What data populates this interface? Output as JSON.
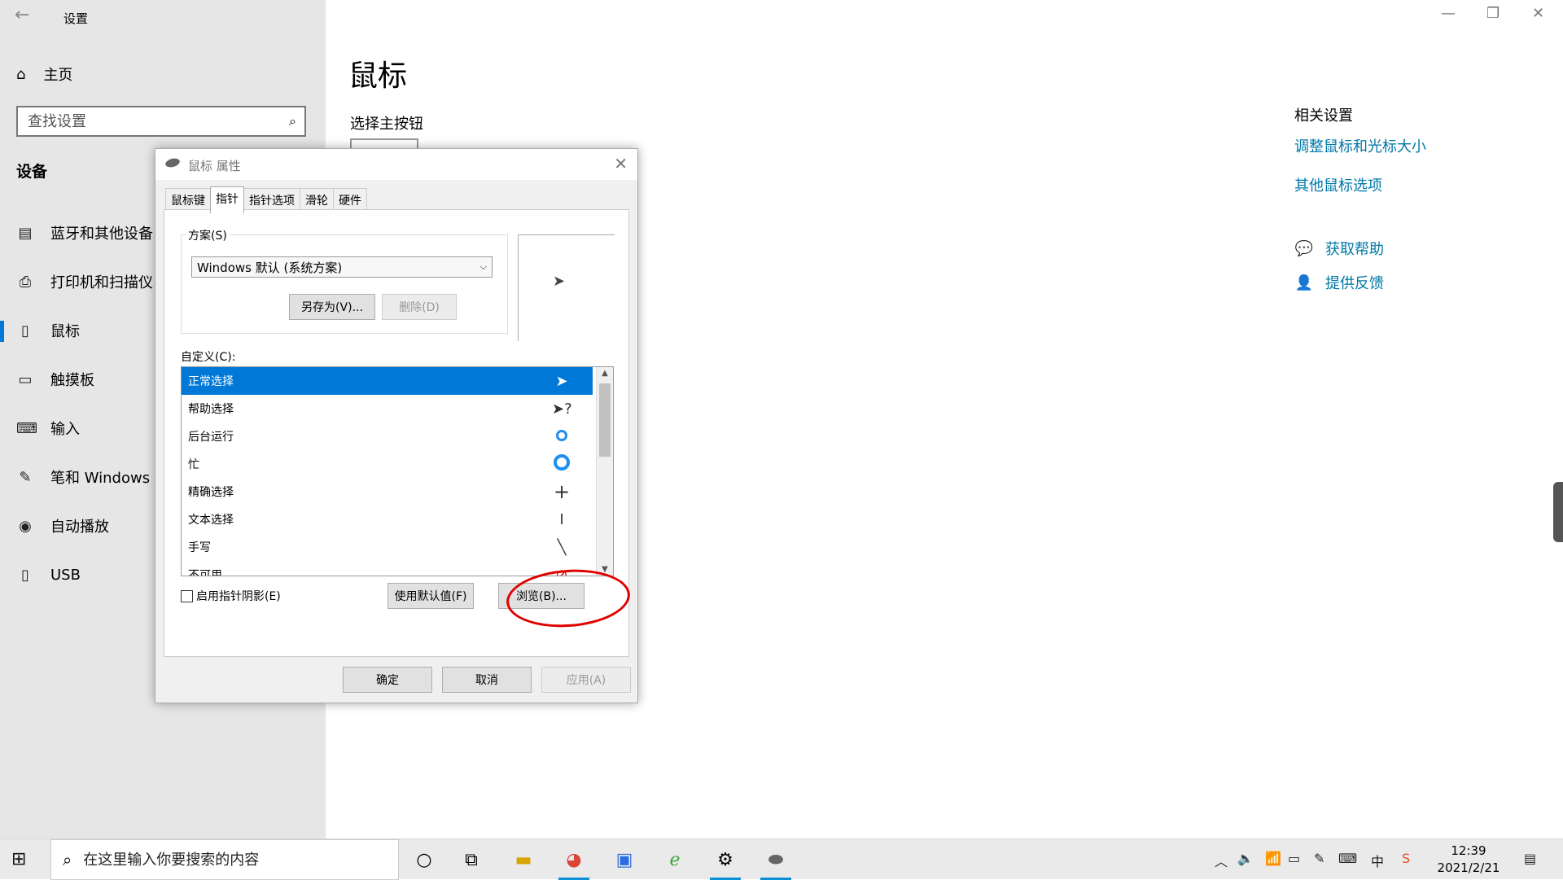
{
  "window": {
    "title": "设置",
    "back_icon": "arrow-left-icon"
  },
  "sidebar": {
    "home_label": "主页",
    "search_placeholder": "查找设置",
    "section_title": "设备",
    "items": [
      {
        "label": "蓝牙和其他设备",
        "icon": "bluetooth-devices-icon"
      },
      {
        "label": "打印机和扫描仪",
        "icon": "printer-icon"
      },
      {
        "label": "鼠标",
        "icon": "mouse-icon",
        "active": true
      },
      {
        "label": "触摸板",
        "icon": "touchpad-icon"
      },
      {
        "label": "输入",
        "icon": "keyboard-icon"
      },
      {
        "label": "笔和 Windows Ink",
        "icon": "pen-icon"
      },
      {
        "label": "自动播放",
        "icon": "autoplay-icon"
      },
      {
        "label": "USB",
        "icon": "usb-icon"
      }
    ]
  },
  "main": {
    "page_title": "鼠标",
    "primary_button_heading": "选择主按钮"
  },
  "related": {
    "heading": "相关设置",
    "links": [
      "调整鼠标和光标大小",
      "其他鼠标选项"
    ],
    "help": "获取帮助",
    "feedback": "提供反馈"
  },
  "dialog": {
    "title": "鼠标 属性",
    "tabs": [
      "鼠标键",
      "指针",
      "指针选项",
      "滑轮",
      "硬件"
    ],
    "active_tab": "指针",
    "scheme_label": "方案(S)",
    "scheme_value": "Windows 默认 (系统方案)",
    "save_as": "另存为(V)...",
    "delete": "删除(D)",
    "customize_label": "自定义(C):",
    "cursors": [
      {
        "label": "正常选择",
        "icon": "arrow-cursor-icon",
        "selected": true
      },
      {
        "label": "帮助选择",
        "icon": "help-cursor-icon"
      },
      {
        "label": "后台运行",
        "icon": "working-cursor-icon"
      },
      {
        "label": "忙",
        "icon": "busy-cursor-icon"
      },
      {
        "label": "精确选择",
        "icon": "crosshair-cursor-icon"
      },
      {
        "label": "文本选择",
        "icon": "ibeam-cursor-icon"
      },
      {
        "label": "手写",
        "icon": "pen-cursor-icon"
      },
      {
        "label": "不可用",
        "icon": "unavailable-cursor-icon"
      }
    ],
    "shadow_label": "启用指针阴影(E)",
    "use_default": "使用默认值(F)",
    "browse": "浏览(B)...",
    "ok": "确定",
    "cancel": "取消",
    "apply": "应用(A)"
  },
  "taskbar": {
    "search_placeholder": "在这里输入你要搜索的内容",
    "apps": [
      "cortana-icon",
      "task-view-icon",
      "file-explorer-icon",
      "chrome-icon",
      "wps-icon",
      "edge-icon",
      "settings-icon",
      "mouse-app-icon"
    ],
    "ime": "中",
    "time": "12:39",
    "date": "2021/2/21"
  },
  "colors": {
    "accent": "#0078d7",
    "link": "#0078a8",
    "annotation": "#e00000"
  }
}
